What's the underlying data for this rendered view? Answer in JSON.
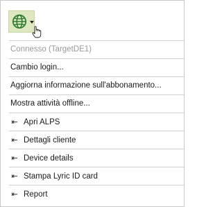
{
  "menu": {
    "status": "Connesso (TargetDE1)",
    "items": [
      "Cambio login...",
      "Aggiorna informazione sull'abbonamento...",
      "Mostra attività offline..."
    ],
    "links": [
      {
        "label": "Apri ALPS",
        "icon": "open-in-icon",
        "glyph": "⇤"
      },
      {
        "label": "Dettagli cliente",
        "icon": "open-in-icon",
        "glyph": "⇤"
      },
      {
        "label": "Device details",
        "icon": "open-in-icon",
        "glyph": "⇤"
      },
      {
        "label": "Stampa Lyric ID card",
        "icon": "open-in-icon",
        "glyph": "⇤"
      },
      {
        "label": "Report",
        "icon": "open-in-icon",
        "glyph": "⇤"
      }
    ]
  },
  "toolbar": {
    "globe_icon": "globe-icon",
    "caret_icon": "chevron-down-icon",
    "cursor_icon": "hand-pointer-icon"
  },
  "colors": {
    "globe": "#2e7d32",
    "button_bg": "#dde8c0",
    "disabled_text": "#9a9a9a"
  }
}
